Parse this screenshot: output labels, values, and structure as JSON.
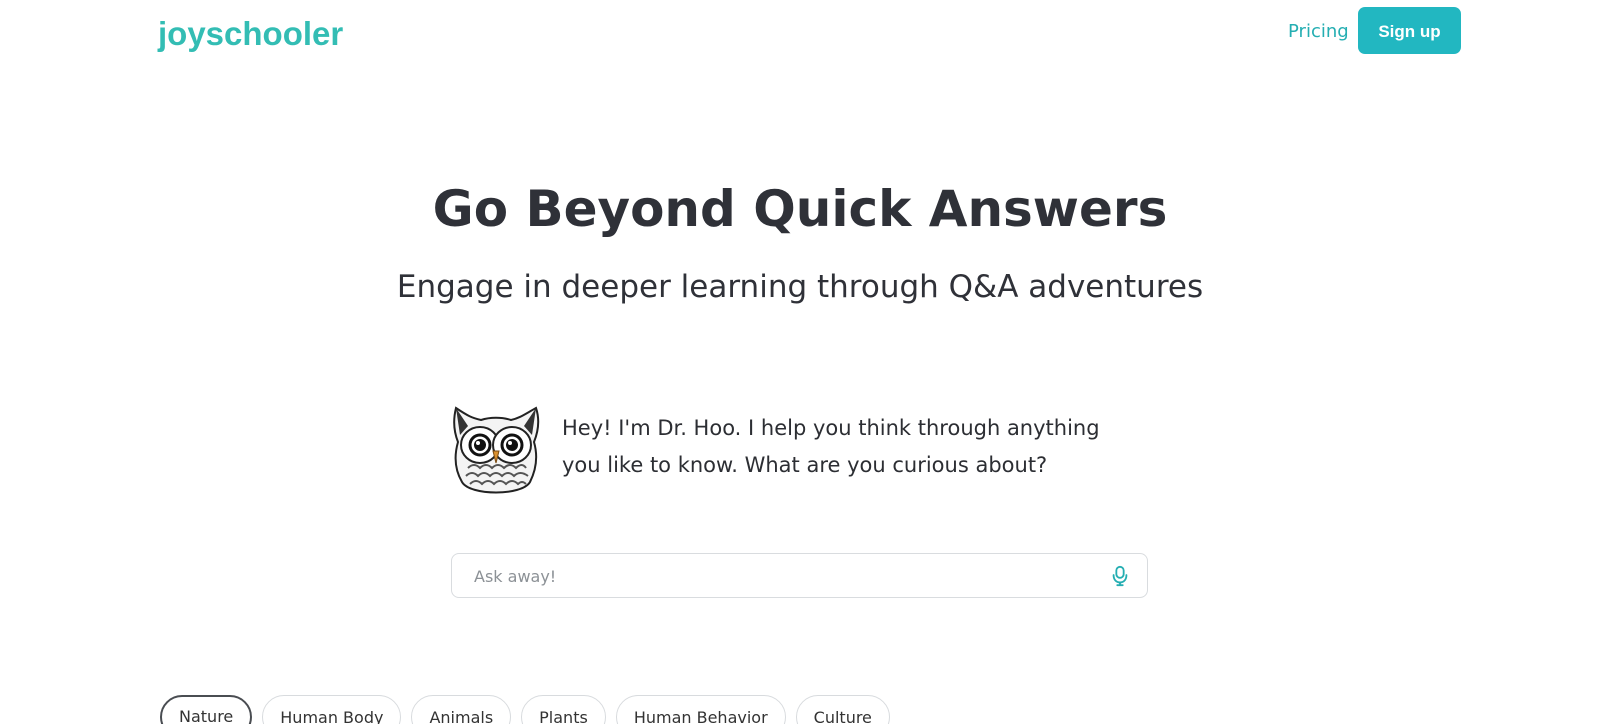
{
  "header": {
    "logo": "joyschooler",
    "pricing_label": "Pricing",
    "signup_label": "Sign up"
  },
  "hero": {
    "title": "Go Beyond Quick Answers",
    "subtitle": "Engage in deeper learning through Q&A adventures"
  },
  "assistant": {
    "avatar_icon": "owl-icon",
    "greeting": "Hey! I'm Dr. Hoo. I help you think through anything you like to know. What are you curious about?"
  },
  "search": {
    "placeholder": "Ask away!",
    "value": "",
    "icon": "microphone-icon"
  },
  "categories": {
    "selected": "Nature",
    "items": [
      "Nature",
      "Human Body",
      "Animals",
      "Plants",
      "Human Behavior",
      "Culture"
    ]
  },
  "colors": {
    "brand": "#33bdb4",
    "button": "#22b7c1",
    "text": "#2f3138"
  }
}
